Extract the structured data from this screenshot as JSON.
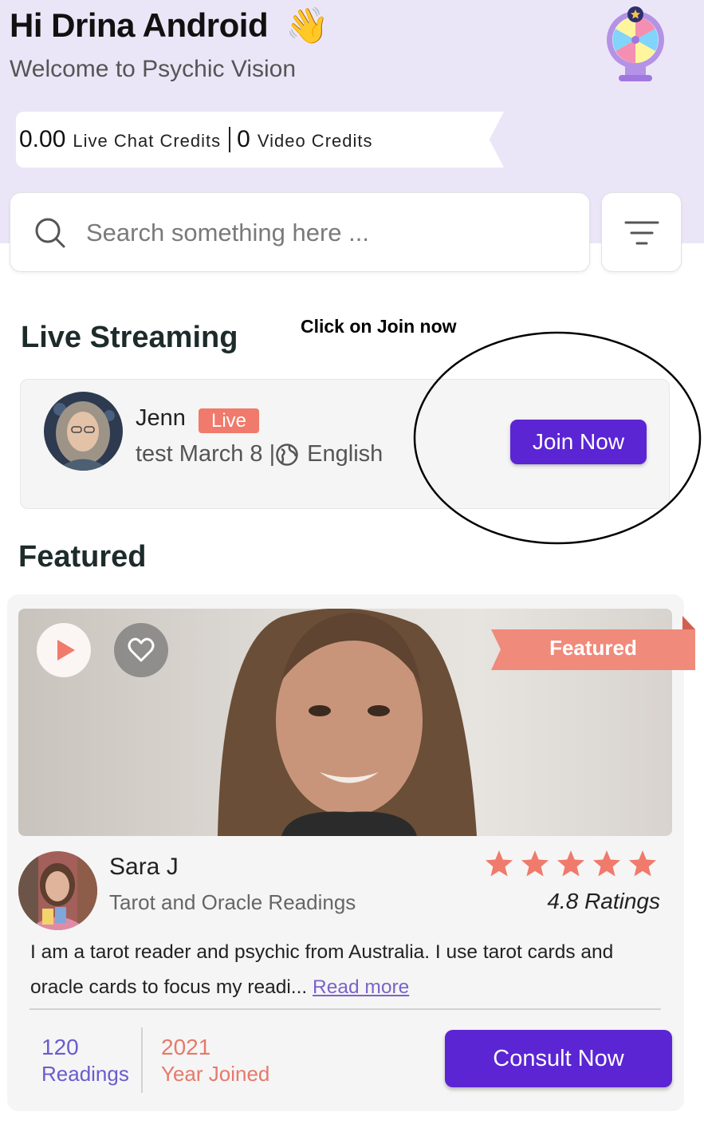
{
  "header": {
    "greeting": "Hi  Drina Android",
    "wave_emoji": "👋",
    "subtitle": "Welcome to Psychic Vision"
  },
  "credits": {
    "live_chat_value": "0.00",
    "live_chat_label": "Live Chat Credits",
    "video_value": "0",
    "video_label": "Video Credits"
  },
  "search": {
    "placeholder": "Search something here ..."
  },
  "annotation": {
    "text": "Click on Join now"
  },
  "live_streaming": {
    "title": "Live Streaming",
    "item": {
      "name": "Jenn",
      "badge": "Live",
      "topic": "test March 8 | ",
      "language": "English",
      "button_label": "Join Now"
    }
  },
  "featured": {
    "title": "Featured",
    "ribbon_label": "Featured",
    "reader": {
      "name": "Sara J",
      "specialty": "Tarot and Oracle Readings",
      "stars": 5,
      "ratings_text": "4.8 Ratings",
      "description": "I am a tarot reader and psychic from Australia. I use tarot cards and oracle cards to focus my readi... ",
      "read_more": "Read more",
      "readings_count": "120",
      "readings_label": "Readings",
      "year_joined": "2021",
      "year_joined_label": "Year Joined",
      "button_label": "Consult Now"
    }
  },
  "colors": {
    "accent": "#5b25d3",
    "badge": "#f07a6b",
    "header_bg": "#ebe6f7",
    "stat_purple": "#6a5ccf",
    "stat_coral": "#e57a6b"
  }
}
